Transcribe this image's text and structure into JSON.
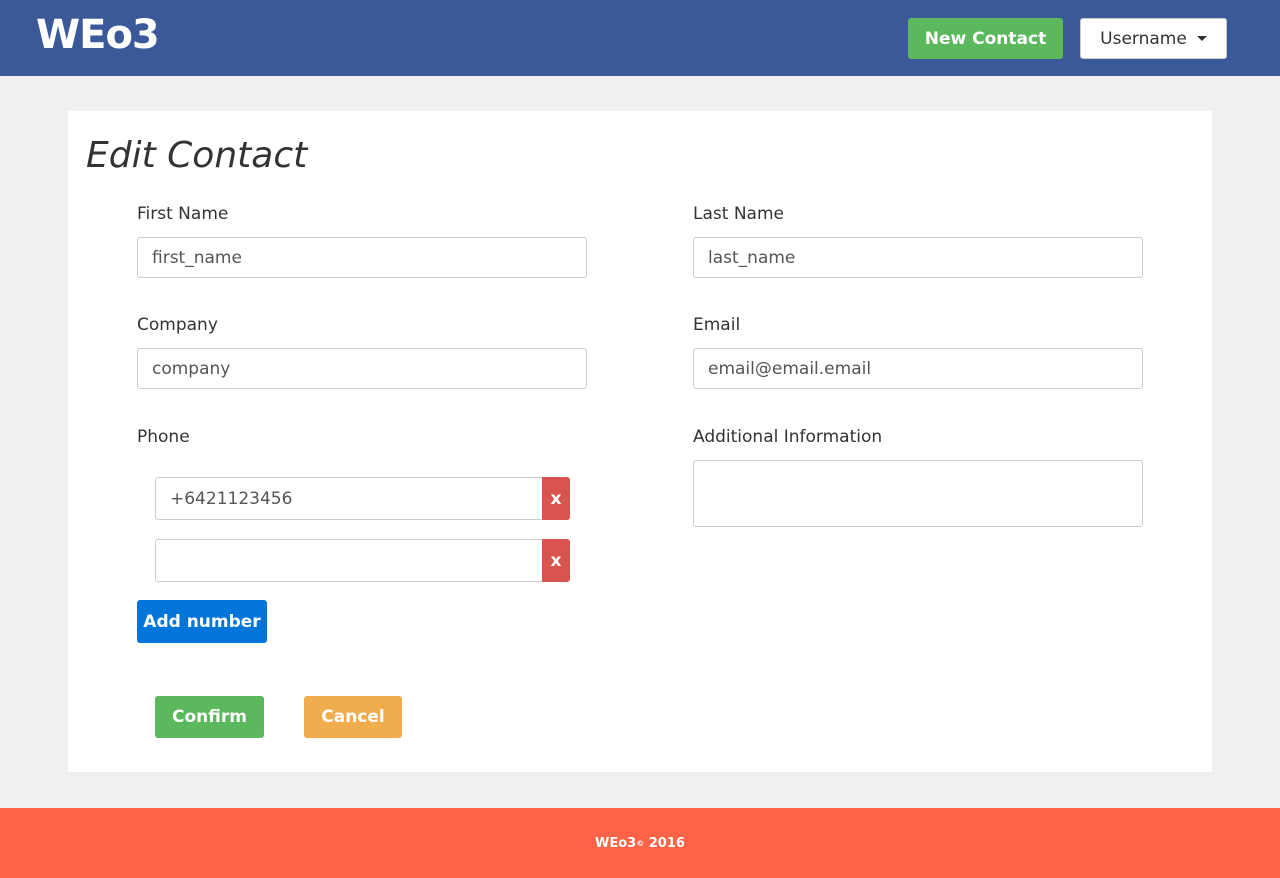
{
  "header": {
    "brand": "WEo3",
    "new_contact_label": "New Contact",
    "username_label": "Username"
  },
  "form": {
    "title": "Edit Contact",
    "first_name": {
      "label": "First Name",
      "value": "first_name"
    },
    "last_name": {
      "label": "Last Name",
      "value": "last_name"
    },
    "company": {
      "label": "Company",
      "value": "company"
    },
    "email": {
      "label": "Email",
      "value": "email@email.email"
    },
    "phone": {
      "label": "Phone",
      "numbers": [
        "+6421123456",
        ""
      ],
      "remove_label": "x",
      "add_label": "Add number"
    },
    "additional_info": {
      "label": "Additional Information",
      "value": ""
    },
    "confirm_label": "Confirm",
    "cancel_label": "Cancel"
  },
  "footer": {
    "brand": "WEo3",
    "copyright_symbol": "©",
    "year": "2016"
  },
  "colors": {
    "navbar": "#3b5998",
    "success": "#5cb85c",
    "danger": "#d9534f",
    "primary": "#0275d8",
    "warning": "#f0ad4e",
    "footer": "#ff6347"
  }
}
